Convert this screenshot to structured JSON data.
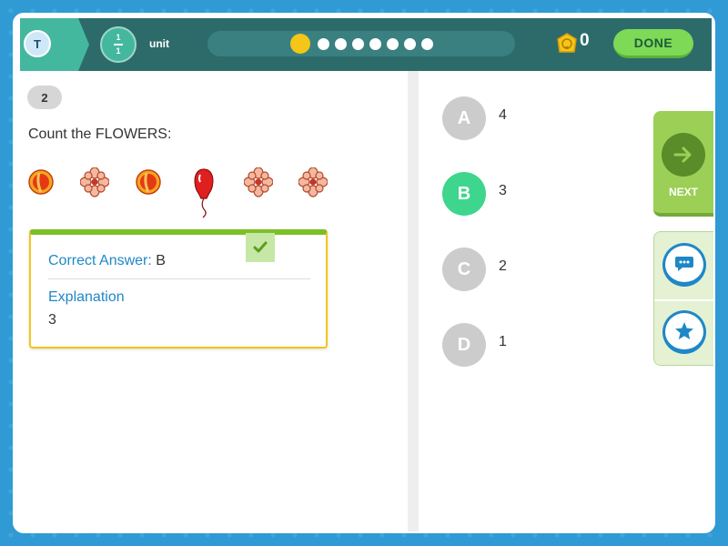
{
  "header": {
    "user_initial": "T",
    "unit_fraction_top": "1",
    "unit_fraction_bottom": "1",
    "unit_label": "unit",
    "progress_current": 1,
    "progress_total": 8,
    "coin_count": "0",
    "done_label": "DONE"
  },
  "question": {
    "number": "2",
    "prompt": "Count the FLOWERS:",
    "objects": [
      "peach",
      "flower",
      "peach",
      "balloon",
      "flower",
      "flower"
    ]
  },
  "answer_card": {
    "correct_label": "Correct Answer:",
    "correct_value": "B",
    "explanation_title": "Explanation",
    "explanation_text": "3"
  },
  "options": [
    {
      "letter": "A",
      "value": "4",
      "selected": false
    },
    {
      "letter": "B",
      "value": "3",
      "selected": true
    },
    {
      "letter": "C",
      "value": "2",
      "selected": false
    },
    {
      "letter": "D",
      "value": "1",
      "selected": false
    }
  ],
  "side": {
    "next_label": "NEXT"
  },
  "colors": {
    "topbar": "#2d6b6b",
    "accent_green": "#7ed957",
    "selected_option": "#3dd68c",
    "link_blue": "#1e88c7",
    "card_border": "#f5c518"
  },
  "icons": {
    "coin": "coin-icon",
    "next": "arrow-right-icon",
    "chat": "chat-icon",
    "star": "star-icon",
    "check": "check-icon"
  }
}
